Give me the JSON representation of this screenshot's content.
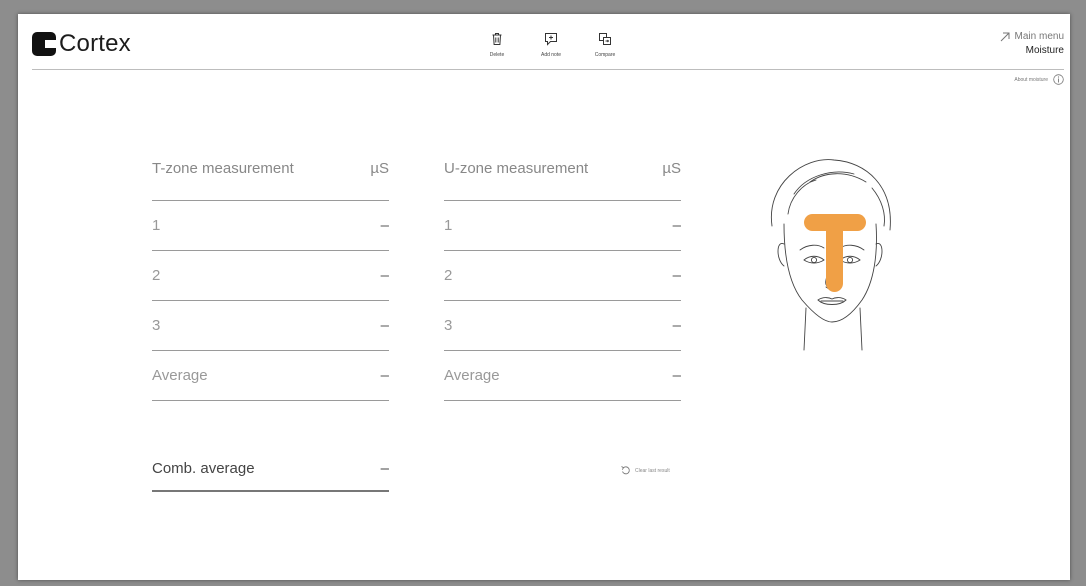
{
  "app": {
    "brand": "Cortex"
  },
  "toolbar": {
    "delete_label": "Delete",
    "add_note_label": "Add note",
    "compare_label": "Compare"
  },
  "nav": {
    "main_menu": "Main menu",
    "section": "Moisture",
    "about": "About moisture"
  },
  "tzone": {
    "title": "T-zone measurement",
    "unit": "µS",
    "rows": [
      {
        "label": "1",
        "value": "–"
      },
      {
        "label": "2",
        "value": "–"
      },
      {
        "label": "3",
        "value": "–"
      },
      {
        "label": "Average",
        "value": "–"
      }
    ]
  },
  "uzone": {
    "title": "U-zone measurement",
    "unit": "µS",
    "rows": [
      {
        "label": "1",
        "value": "–"
      },
      {
        "label": "2",
        "value": "–"
      },
      {
        "label": "3",
        "value": "–"
      },
      {
        "label": "Average",
        "value": "–"
      }
    ]
  },
  "combined": {
    "label": "Comb. average",
    "value": "–"
  },
  "actions": {
    "clear_label": "Clear last result"
  },
  "colors": {
    "accent": "#f0a046",
    "rule": "#9a9a9a",
    "background": "#ffffff"
  },
  "icons": [
    "logo-mark-icon",
    "trash-icon",
    "add-note-icon",
    "compare-icon",
    "arrow-up-right-icon",
    "info-icon",
    "undo-icon",
    "face-illustration"
  ]
}
